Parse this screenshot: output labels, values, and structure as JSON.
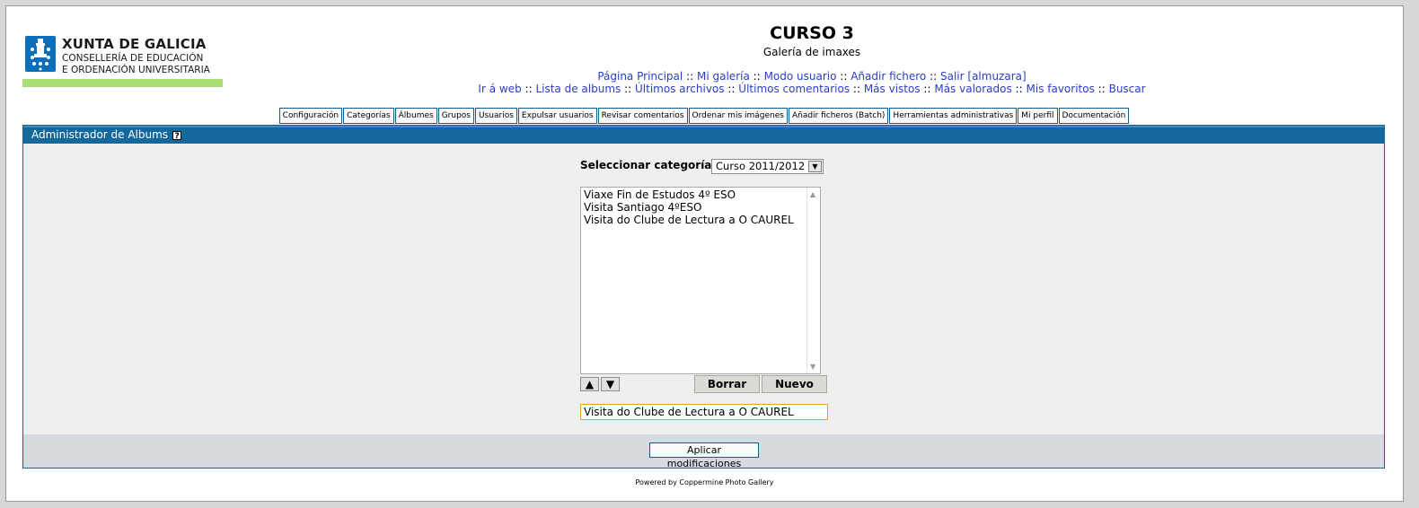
{
  "logo": {
    "line1": "XUNTA DE GALICIA",
    "line2": "CONSELLERÍA DE EDUCACIÓN",
    "line3": "E ORDENACIÓN UNIVERSITARIA"
  },
  "header": {
    "title": "CURSO 3",
    "description": "Galería de imaxes"
  },
  "nav": {
    "row1": [
      "Página Principal",
      "Mi galería",
      "Modo usuario",
      "Añadir fichero",
      "Salir [almuzara]"
    ],
    "row2": [
      "Ir á web",
      "Lista de albums",
      "Últimos archivos",
      "Últimos comentarios",
      "Más vistos",
      "Más valorados",
      "Mis favoritos",
      "Buscar"
    ],
    "separator": "::"
  },
  "admin_tabs": [
    "Configuración",
    "Categorías",
    "Álbumes",
    "Grupos",
    "Usuarios",
    "Expulsar usuarios",
    "Revisar comentarios",
    "Ordenar mis imágenes",
    "Añadir ficheros (Batch)",
    "Herramientas administrativas",
    "Mi perfil",
    "Documentación"
  ],
  "panel": {
    "title": "Administrador de Albums",
    "help_icon": "?",
    "category_label": "Seleccionar categoría",
    "category_value": "Curso 2011/2012",
    "albums": [
      "Viaxe Fin de Estudos 4º ESO",
      "Visita Santiago 4ºESO",
      "Visita do Clube de Lectura a O CAUREL"
    ],
    "delete_label": "Borrar",
    "new_label": "Nuevo",
    "edit_value": "Visita do Clube de Lectura a O CAUREL",
    "apply_label": "Aplicar modificaciones"
  },
  "footer": {
    "powered": "Powered by Coppermine Photo Gallery"
  },
  "colors": {
    "panel_header": "#14689b",
    "link": "#2a3fbf",
    "logo_bar": "#a7df74",
    "logo_blue": "#0a6fb8"
  }
}
